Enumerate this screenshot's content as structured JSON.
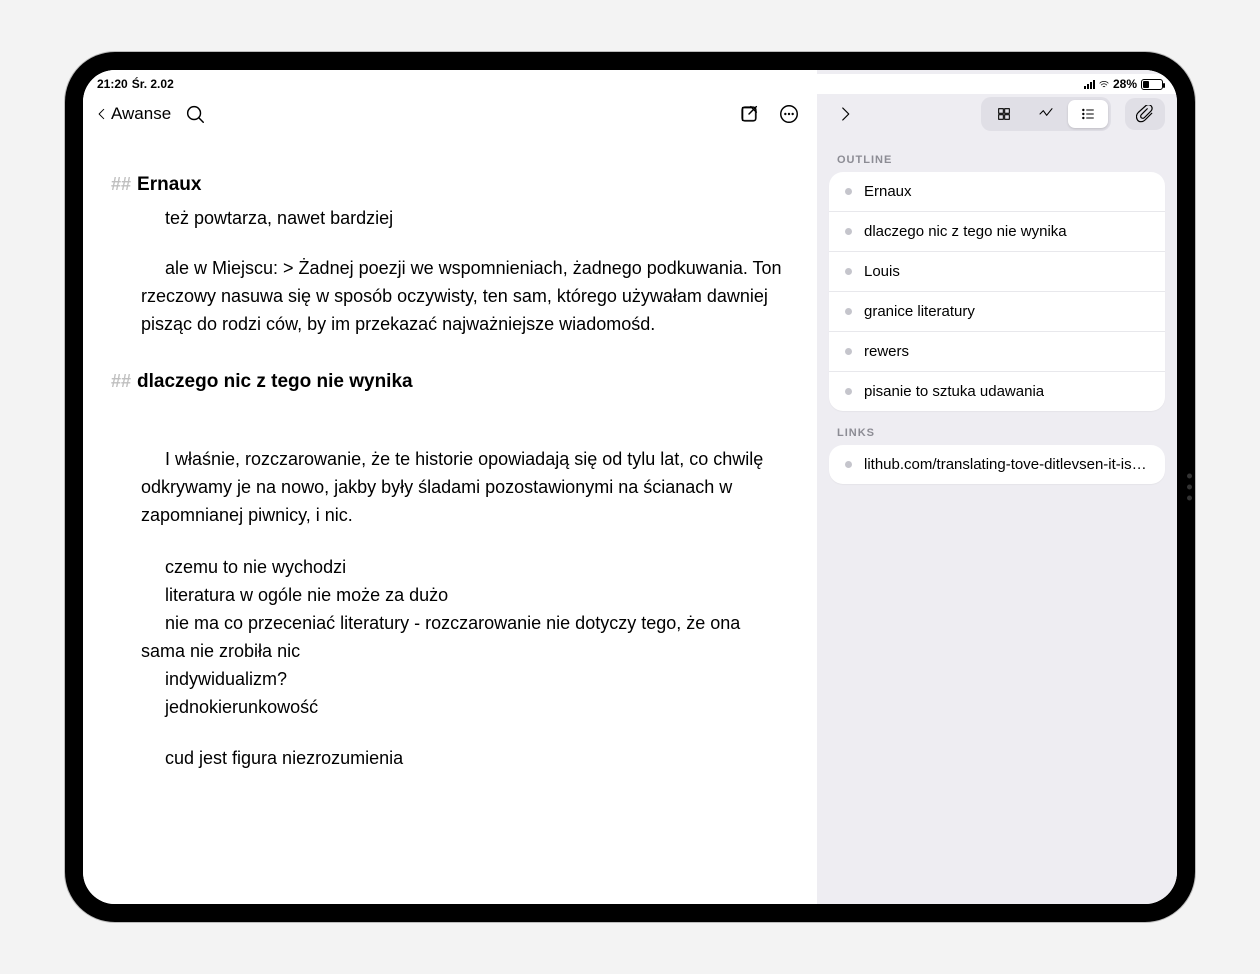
{
  "status": {
    "time": "21:20",
    "date": "Śr. 2.02",
    "battery_pct": "28%"
  },
  "toolbar": {
    "back_label": "Awanse"
  },
  "note": {
    "h1": "Ernaux",
    "line1": "też powtarza, nawet bardziej",
    "para1": "ale w Miejscu: > Żadnej poezji we wspomnieniach, żadnego podkuwania. Ton rzeczowy nasuwa się w sposób oczywisty, ten sam, którego używałam dawniej pisząc do rodzi ców, by im przekazać najważniejsze wiadomośd.",
    "h2": "dlaczego nic z tego nie wynika",
    "para2": "I właśnie, rozczarowanie, że te historie opowiadają się od tylu lat, co chwilę odkrywamy je na nowo, jakby były śladami pozostawionymi na ścianach w zapomnianej piwnicy, i nic.",
    "line2": "czemu to nie wychodzi",
    "line3": "literatura w ogóle nie może za dużo",
    "para3": "nie ma co przeceniać literatury - rozczarowanie nie dotyczy tego, że ona sama nie zrobiła nic",
    "line4": "indywidualizm?",
    "line5": "jednokierunkowość",
    "line6": "cud jest figura niezrozumienia"
  },
  "outline": {
    "label": "OUTLINE",
    "items": [
      "Ernaux",
      "dlaczego nic z tego nie wynika",
      "Louis",
      "granice literatury",
      "rewers",
      "pisanie to sztuka udawania"
    ]
  },
  "links": {
    "label": "LINKS",
    "items": [
      "lithub.com/translating-tove-ditlevsen-it-is…"
    ]
  }
}
